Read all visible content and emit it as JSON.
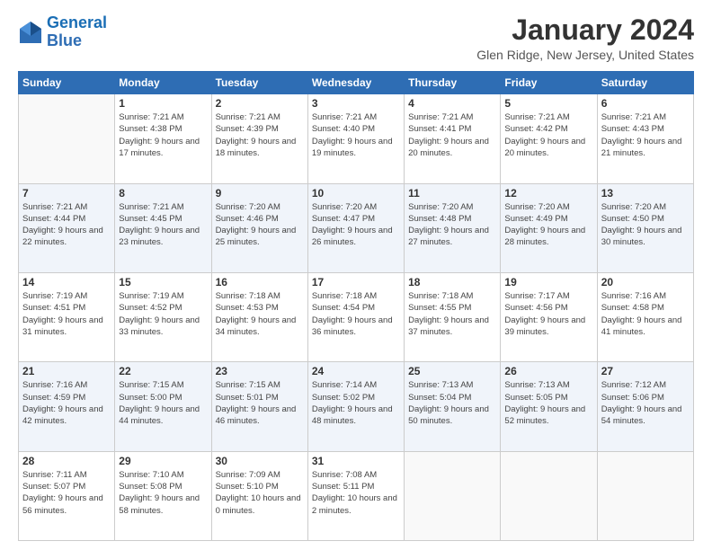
{
  "header": {
    "logo_line1": "General",
    "logo_line2": "Blue",
    "month_title": "January 2024",
    "location": "Glen Ridge, New Jersey, United States"
  },
  "columns": [
    "Sunday",
    "Monday",
    "Tuesday",
    "Wednesday",
    "Thursday",
    "Friday",
    "Saturday"
  ],
  "weeks": [
    [
      {
        "day": "",
        "sunrise": "",
        "sunset": "",
        "daylight": ""
      },
      {
        "day": "1",
        "sunrise": "Sunrise: 7:21 AM",
        "sunset": "Sunset: 4:38 PM",
        "daylight": "Daylight: 9 hours and 17 minutes."
      },
      {
        "day": "2",
        "sunrise": "Sunrise: 7:21 AM",
        "sunset": "Sunset: 4:39 PM",
        "daylight": "Daylight: 9 hours and 18 minutes."
      },
      {
        "day": "3",
        "sunrise": "Sunrise: 7:21 AM",
        "sunset": "Sunset: 4:40 PM",
        "daylight": "Daylight: 9 hours and 19 minutes."
      },
      {
        "day": "4",
        "sunrise": "Sunrise: 7:21 AM",
        "sunset": "Sunset: 4:41 PM",
        "daylight": "Daylight: 9 hours and 20 minutes."
      },
      {
        "day": "5",
        "sunrise": "Sunrise: 7:21 AM",
        "sunset": "Sunset: 4:42 PM",
        "daylight": "Daylight: 9 hours and 20 minutes."
      },
      {
        "day": "6",
        "sunrise": "Sunrise: 7:21 AM",
        "sunset": "Sunset: 4:43 PM",
        "daylight": "Daylight: 9 hours and 21 minutes."
      }
    ],
    [
      {
        "day": "7",
        "sunrise": "Sunrise: 7:21 AM",
        "sunset": "Sunset: 4:44 PM",
        "daylight": "Daylight: 9 hours and 22 minutes."
      },
      {
        "day": "8",
        "sunrise": "Sunrise: 7:21 AM",
        "sunset": "Sunset: 4:45 PM",
        "daylight": "Daylight: 9 hours and 23 minutes."
      },
      {
        "day": "9",
        "sunrise": "Sunrise: 7:20 AM",
        "sunset": "Sunset: 4:46 PM",
        "daylight": "Daylight: 9 hours and 25 minutes."
      },
      {
        "day": "10",
        "sunrise": "Sunrise: 7:20 AM",
        "sunset": "Sunset: 4:47 PM",
        "daylight": "Daylight: 9 hours and 26 minutes."
      },
      {
        "day": "11",
        "sunrise": "Sunrise: 7:20 AM",
        "sunset": "Sunset: 4:48 PM",
        "daylight": "Daylight: 9 hours and 27 minutes."
      },
      {
        "day": "12",
        "sunrise": "Sunrise: 7:20 AM",
        "sunset": "Sunset: 4:49 PM",
        "daylight": "Daylight: 9 hours and 28 minutes."
      },
      {
        "day": "13",
        "sunrise": "Sunrise: 7:20 AM",
        "sunset": "Sunset: 4:50 PM",
        "daylight": "Daylight: 9 hours and 30 minutes."
      }
    ],
    [
      {
        "day": "14",
        "sunrise": "Sunrise: 7:19 AM",
        "sunset": "Sunset: 4:51 PM",
        "daylight": "Daylight: 9 hours and 31 minutes."
      },
      {
        "day": "15",
        "sunrise": "Sunrise: 7:19 AM",
        "sunset": "Sunset: 4:52 PM",
        "daylight": "Daylight: 9 hours and 33 minutes."
      },
      {
        "day": "16",
        "sunrise": "Sunrise: 7:18 AM",
        "sunset": "Sunset: 4:53 PM",
        "daylight": "Daylight: 9 hours and 34 minutes."
      },
      {
        "day": "17",
        "sunrise": "Sunrise: 7:18 AM",
        "sunset": "Sunset: 4:54 PM",
        "daylight": "Daylight: 9 hours and 36 minutes."
      },
      {
        "day": "18",
        "sunrise": "Sunrise: 7:18 AM",
        "sunset": "Sunset: 4:55 PM",
        "daylight": "Daylight: 9 hours and 37 minutes."
      },
      {
        "day": "19",
        "sunrise": "Sunrise: 7:17 AM",
        "sunset": "Sunset: 4:56 PM",
        "daylight": "Daylight: 9 hours and 39 minutes."
      },
      {
        "day": "20",
        "sunrise": "Sunrise: 7:16 AM",
        "sunset": "Sunset: 4:58 PM",
        "daylight": "Daylight: 9 hours and 41 minutes."
      }
    ],
    [
      {
        "day": "21",
        "sunrise": "Sunrise: 7:16 AM",
        "sunset": "Sunset: 4:59 PM",
        "daylight": "Daylight: 9 hours and 42 minutes."
      },
      {
        "day": "22",
        "sunrise": "Sunrise: 7:15 AM",
        "sunset": "Sunset: 5:00 PM",
        "daylight": "Daylight: 9 hours and 44 minutes."
      },
      {
        "day": "23",
        "sunrise": "Sunrise: 7:15 AM",
        "sunset": "Sunset: 5:01 PM",
        "daylight": "Daylight: 9 hours and 46 minutes."
      },
      {
        "day": "24",
        "sunrise": "Sunrise: 7:14 AM",
        "sunset": "Sunset: 5:02 PM",
        "daylight": "Daylight: 9 hours and 48 minutes."
      },
      {
        "day": "25",
        "sunrise": "Sunrise: 7:13 AM",
        "sunset": "Sunset: 5:04 PM",
        "daylight": "Daylight: 9 hours and 50 minutes."
      },
      {
        "day": "26",
        "sunrise": "Sunrise: 7:13 AM",
        "sunset": "Sunset: 5:05 PM",
        "daylight": "Daylight: 9 hours and 52 minutes."
      },
      {
        "day": "27",
        "sunrise": "Sunrise: 7:12 AM",
        "sunset": "Sunset: 5:06 PM",
        "daylight": "Daylight: 9 hours and 54 minutes."
      }
    ],
    [
      {
        "day": "28",
        "sunrise": "Sunrise: 7:11 AM",
        "sunset": "Sunset: 5:07 PM",
        "daylight": "Daylight: 9 hours and 56 minutes."
      },
      {
        "day": "29",
        "sunrise": "Sunrise: 7:10 AM",
        "sunset": "Sunset: 5:08 PM",
        "daylight": "Daylight: 9 hours and 58 minutes."
      },
      {
        "day": "30",
        "sunrise": "Sunrise: 7:09 AM",
        "sunset": "Sunset: 5:10 PM",
        "daylight": "Daylight: 10 hours and 0 minutes."
      },
      {
        "day": "31",
        "sunrise": "Sunrise: 7:08 AM",
        "sunset": "Sunset: 5:11 PM",
        "daylight": "Daylight: 10 hours and 2 minutes."
      },
      {
        "day": "",
        "sunrise": "",
        "sunset": "",
        "daylight": ""
      },
      {
        "day": "",
        "sunrise": "",
        "sunset": "",
        "daylight": ""
      },
      {
        "day": "",
        "sunrise": "",
        "sunset": "",
        "daylight": ""
      }
    ]
  ]
}
